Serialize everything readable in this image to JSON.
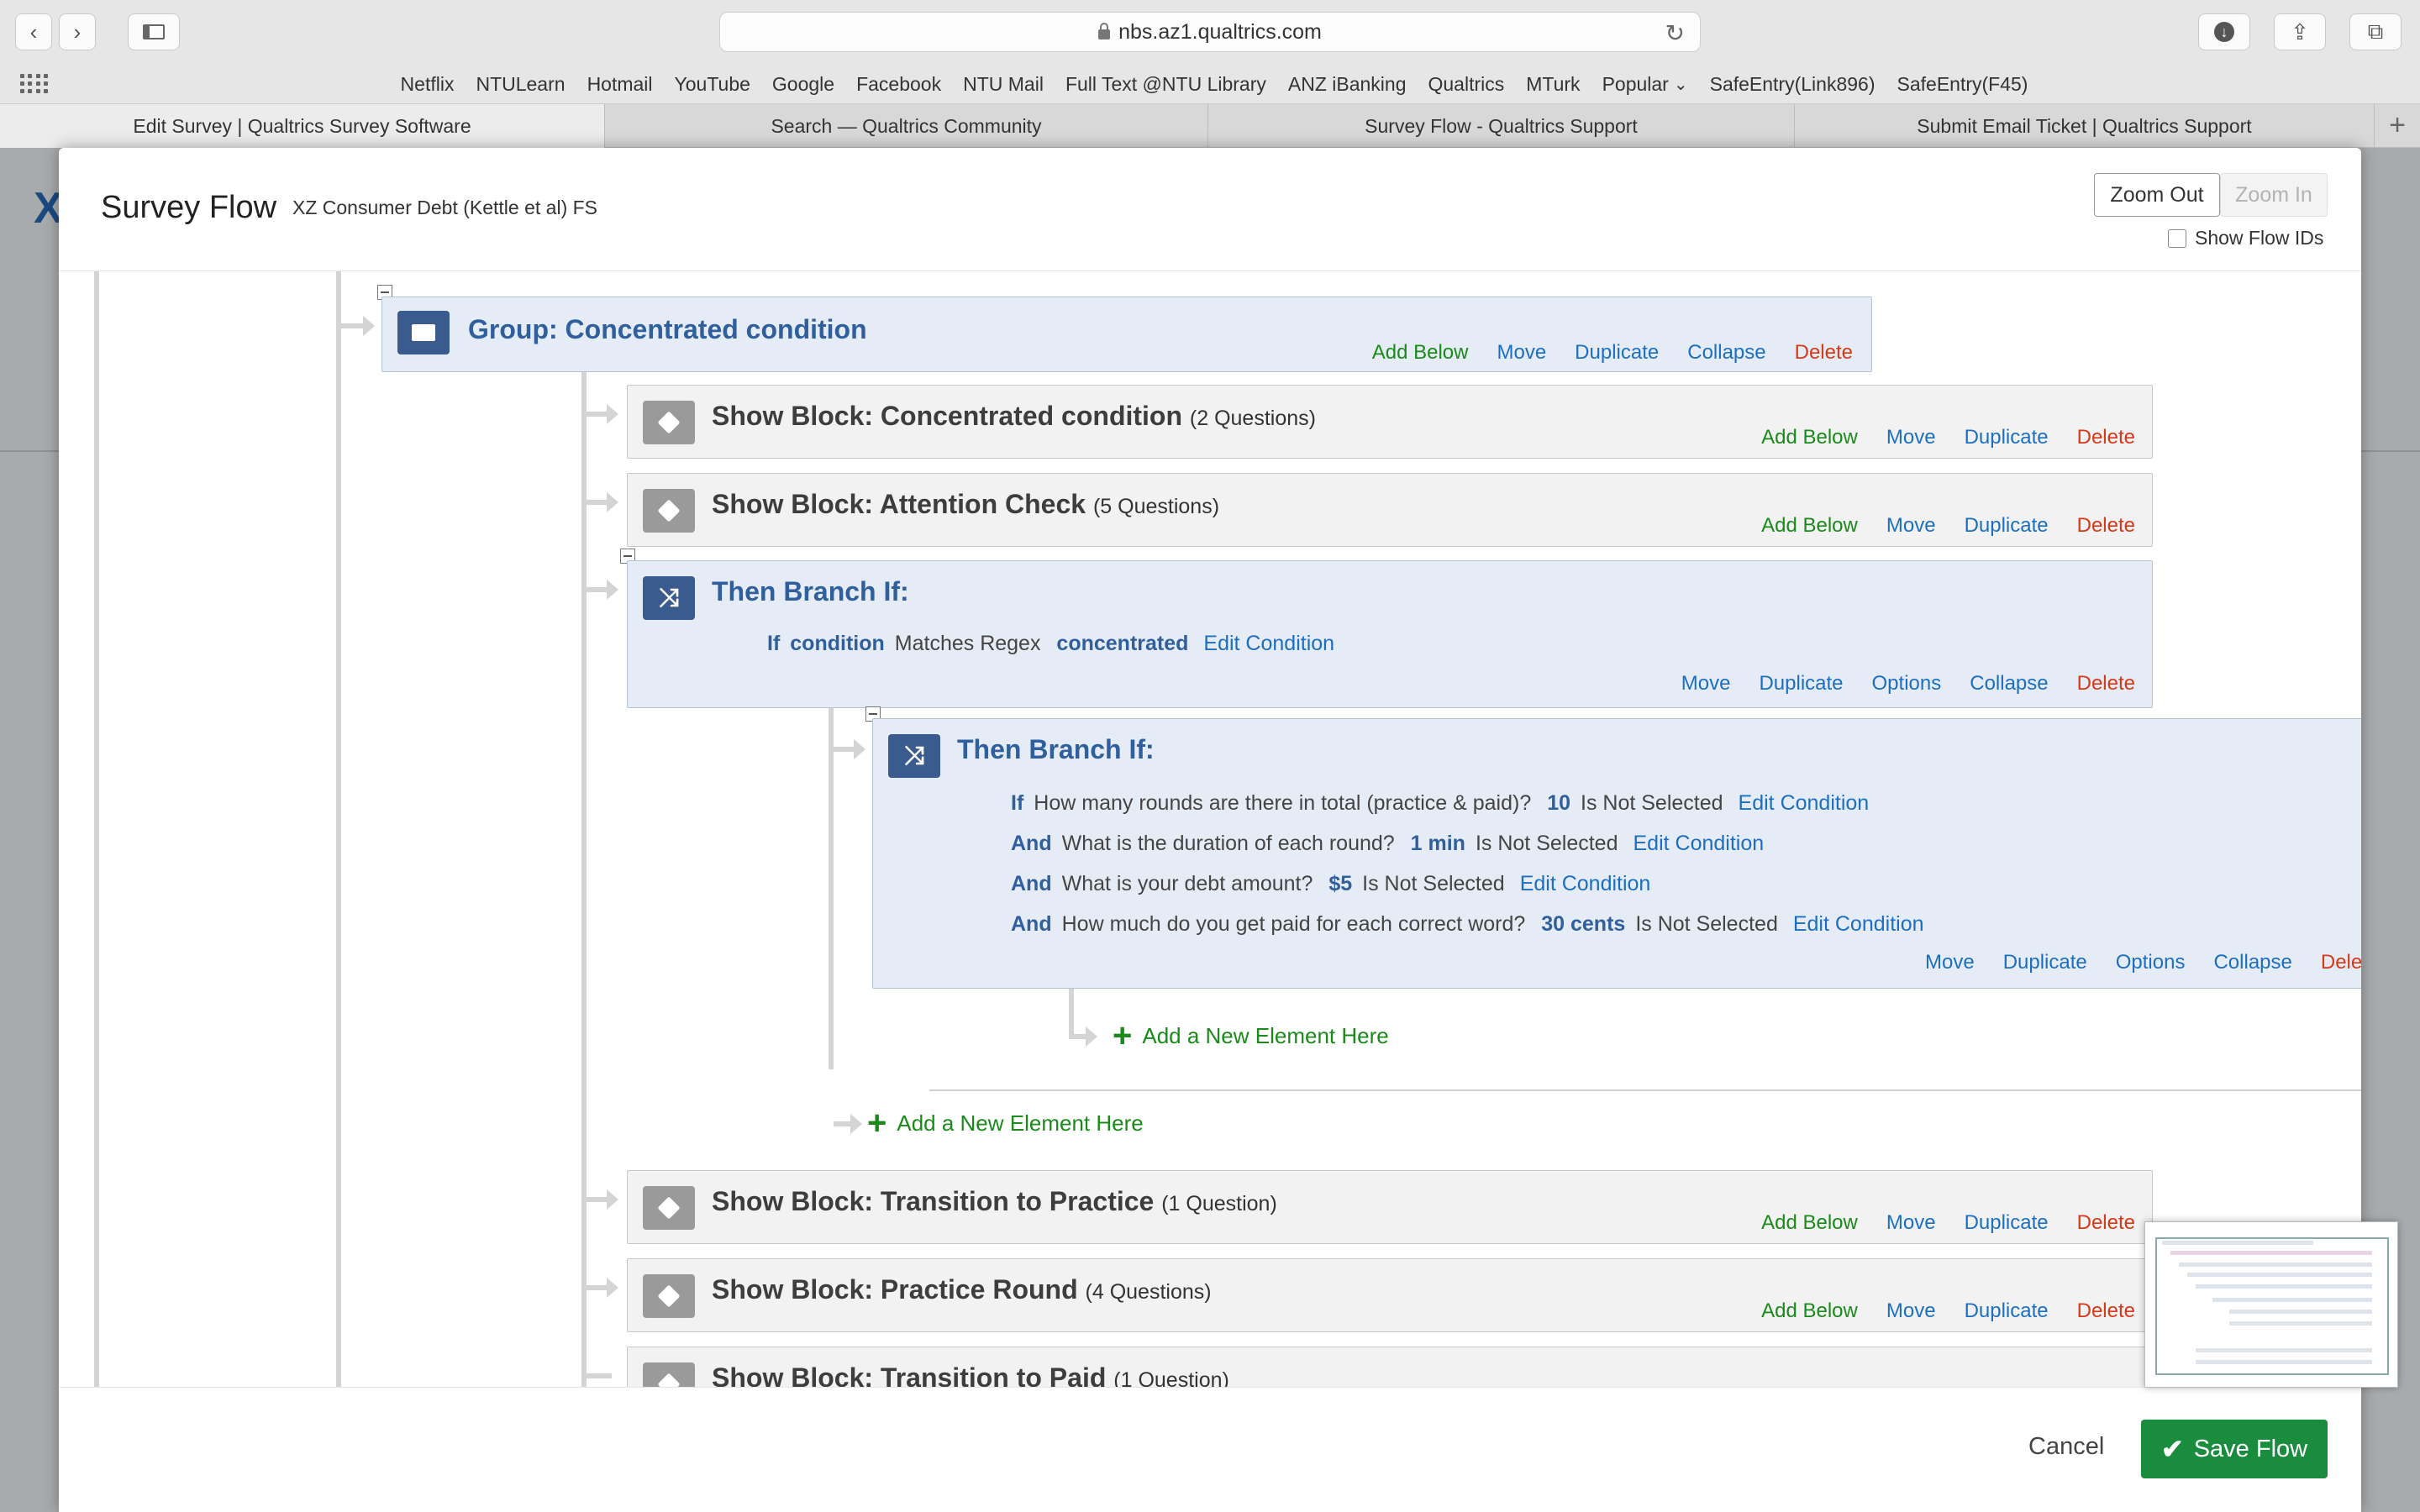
{
  "browser": {
    "url": "nbs.az1.qualtrics.com",
    "favorites": [
      "Netflix",
      "NTULearn",
      "Hotmail",
      "YouTube",
      "Google",
      "Facebook",
      "NTU Mail",
      "Full Text @NTU Library",
      "ANZ iBanking",
      "Qualtrics",
      "MTurk",
      "Popular",
      "SafeEntry(Link896)",
      "SafeEntry(F45)"
    ],
    "tabs": [
      "Edit Survey | Qualtrics Survey Software",
      "Search — Qualtrics Community",
      "Survey Flow - Qualtrics Support",
      "Submit Email Ticket | Qualtrics Support"
    ]
  },
  "modal": {
    "title": "Survey Flow",
    "subtitle": "XZ Consumer Debt (Kettle et al) FS",
    "zoom_out": "Zoom Out",
    "zoom_in": "Zoom In",
    "show_flow_ids": "Show Flow IDs",
    "cancel": "Cancel",
    "save": "Save Flow"
  },
  "actions": {
    "add_below": "Add Below",
    "move": "Move",
    "duplicate": "Duplicate",
    "collapse": "Collapse",
    "delete": "Delete",
    "options": "Options",
    "delete_clipped": "Dele",
    "edit_condition": "Edit Condition",
    "add_new_element": "Add a New Element Here"
  },
  "flow": {
    "group": {
      "title": "Group: Concentrated condition"
    },
    "block_concentrated": {
      "title": "Show Block: Concentrated condition",
      "count": "(2 Questions)"
    },
    "block_attention": {
      "title": "Show Block: Attention Check",
      "count": "(5 Questions)"
    },
    "branch1": {
      "title": "Then Branch If:",
      "cond_kw": "If",
      "cond_field": "condition",
      "cond_op": "Matches Regex",
      "cond_val": "concentrated"
    },
    "branch2": {
      "title": "Then Branch If:",
      "conditions": [
        {
          "kw": "If",
          "question": "How many rounds are there in total (practice & paid)?",
          "value": "10",
          "op": "Is Not Selected"
        },
        {
          "kw": "And",
          "question": "What is the duration of each round?",
          "value": "1 min",
          "op": "Is Not Selected"
        },
        {
          "kw": "And",
          "question": "What is your debt amount?",
          "value": "$5",
          "op": "Is Not Selected"
        },
        {
          "kw": "And",
          "question": "How much do you get paid for each correct word?",
          "value": "30 cents",
          "op": "Is Not Selected"
        }
      ]
    },
    "block_transition_practice": {
      "title": "Show Block: Transition to Practice",
      "count": "(1 Question)"
    },
    "block_practice": {
      "title": "Show Block: Practice Round",
      "count": "(4 Questions)"
    },
    "block_transition_paid": {
      "title": "Show Block: Transition to Paid",
      "count": "(1 Question)"
    }
  }
}
